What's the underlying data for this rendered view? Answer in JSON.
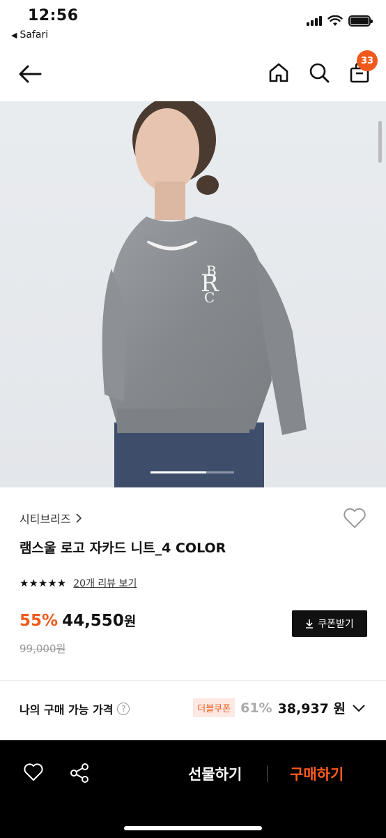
{
  "status_bar": {
    "time": "12:56",
    "back_app": "Safari"
  },
  "nav": {
    "cart_count": "33",
    "icons": [
      "back-arrow-icon",
      "home-icon",
      "search-icon",
      "shopping-bag-icon"
    ]
  },
  "hero": {
    "image_subject": "model wearing grey knit sweater with logo",
    "sweater_color": "#8a8d90",
    "background_color": "#e7eaee"
  },
  "product": {
    "brand": "시티브리즈",
    "name": "램스울 로고 자카드 니트_4 COLOR",
    "stars": "★★★★★",
    "review_link": "20개 리뷰 보기",
    "discount": "55%",
    "price": "44,550",
    "price_unit": "원",
    "original_price": "99,000원",
    "coupon_button": "쿠폰받기"
  },
  "my_price": {
    "label": "나의 구매 가능 가격",
    "help": "?",
    "badge": "더블쿠폰",
    "discount": "61%",
    "price": "38,937 원"
  },
  "bottom_bar": {
    "gift_label": "선물하기",
    "buy_label": "구매하기"
  },
  "colors": {
    "accent": "#ef5a1c",
    "buy": "#ff5a1f",
    "dark": "#111111"
  }
}
